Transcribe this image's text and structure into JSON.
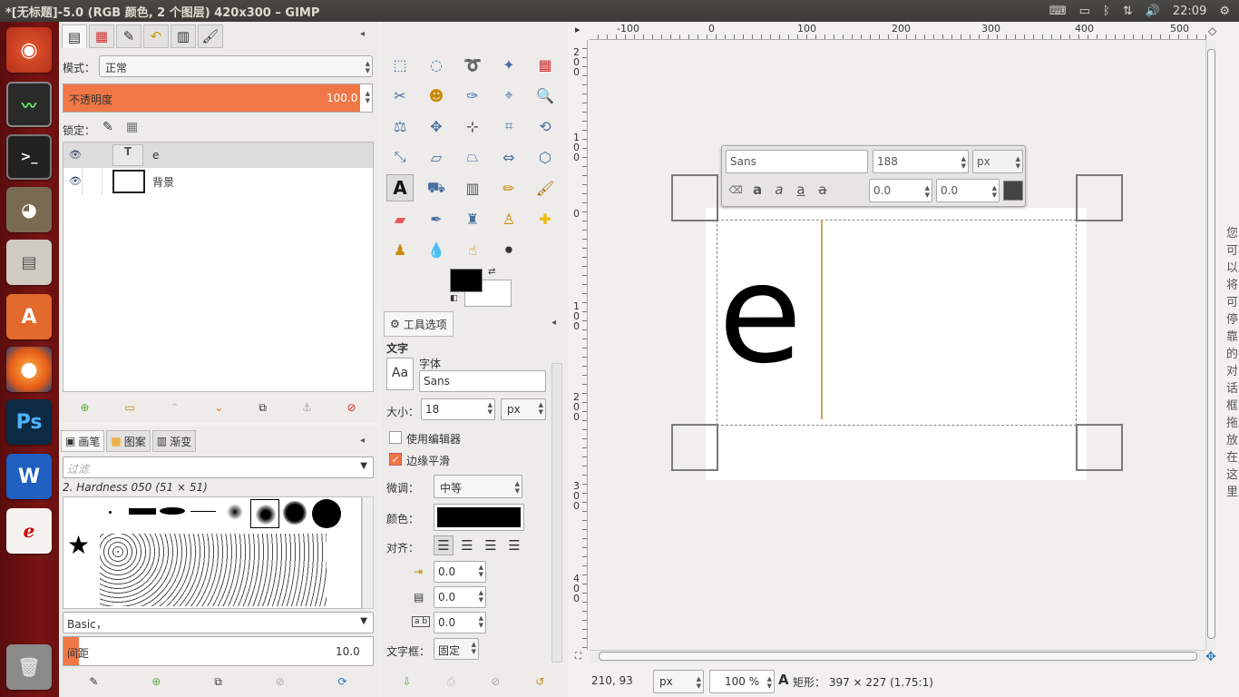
{
  "window": {
    "title": "*[无标题]-5.0 (RGB 颜色, 2 个图层) 420x300 – GIMP",
    "time": "22:09"
  },
  "topbar": {
    "icons": [
      "keyboard-icon",
      "battery-icon",
      "bluetooth-icon",
      "network-icon",
      "volume-icon",
      "gear-icon"
    ]
  },
  "launcher": {
    "items": [
      "Ubuntu",
      "System Monitor",
      "Terminal",
      "GIMP",
      "Files",
      "Software Center",
      "Firefox",
      "Ps",
      "W",
      "Document Viewer",
      "Trash"
    ]
  },
  "layers": {
    "mode_label": "模式：",
    "mode_value": "正常",
    "opacity_label": "不透明度",
    "opacity_value": "100.0",
    "lock_label": "锁定：",
    "items": [
      {
        "name": "e",
        "thumb": "T"
      },
      {
        "name": "背景",
        "thumb": ""
      }
    ]
  },
  "brushes": {
    "tabs": [
      "画笔",
      "图案",
      "渐变"
    ],
    "filter_placeholder": "过滤",
    "selected": "2. Hardness 050 (51 × 51)",
    "preset": "Basic，",
    "spacing_label": "间距",
    "spacing_value": "10.0"
  },
  "tool_options": {
    "tab": "工具选项",
    "section": "文字",
    "font_label": "字体",
    "font_value": "Sans",
    "font_preview": "Aa",
    "size_label": "大小：",
    "size_value": "18",
    "size_unit": "px",
    "use_editor": "使用编辑器",
    "antialias": "边缘平滑",
    "hinting_label": "微调：",
    "hinting_value": "中等",
    "color_label": "颜色：",
    "justify_label": "对齐：",
    "indent_value": "0.0",
    "line_spacing_value": "0.0",
    "letter_spacing_value": "0.0",
    "box_label": "文字框：",
    "box_value": "固定"
  },
  "text_overlay": {
    "font": "Sans",
    "size": "188",
    "unit": "px",
    "baseline": "0.0",
    "kerning": "0.0"
  },
  "canvas": {
    "text": "e",
    "side_text": "您可以将可停靠的对话框拖放在这里",
    "hruler": [
      "-100",
      "0",
      "100",
      "200",
      "300",
      "400",
      "500"
    ],
    "vruler": [
      "200",
      "100",
      "0",
      "100",
      "200",
      "300",
      "400"
    ]
  },
  "status": {
    "coords": "210, 93",
    "unit": "px",
    "zoom": "100 %",
    "message": "矩形： 397 × 227 (1.75:1)"
  },
  "colors": {
    "accent": "#f07746",
    "launcher": "#6a1010",
    "topbar": "#3c3b37"
  }
}
